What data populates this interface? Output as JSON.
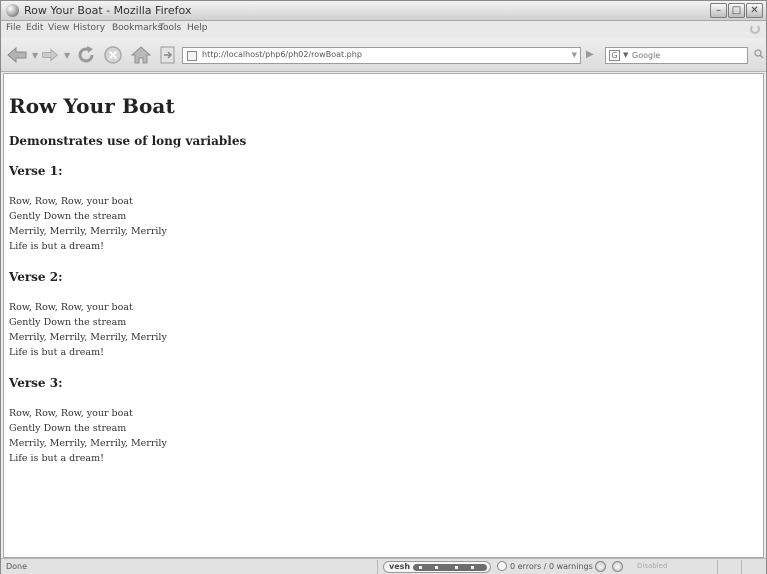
{
  "window": {
    "title": "Row Your Boat - Mozilla Firefox",
    "controls": [
      "minimize",
      "maximize",
      "close"
    ]
  },
  "menubar": {
    "items": [
      "File",
      "Edit",
      "View",
      "History",
      "Bookmarks",
      "Tools",
      "Help"
    ]
  },
  "navbar": {
    "url": "http://localhost/php6/ph02/rowBoat.php",
    "search_placeholder": "Google",
    "search_engine_letter": "G"
  },
  "page": {
    "heading": "Row Your Boat",
    "subheading": "Demonstrates use of long variables",
    "verses": [
      {
        "title": "Verse 1:",
        "lines": [
          "Row, Row, Row, your boat",
          "Gently Down the stream",
          "Merrily, Merrily, Merrily, Merrily",
          "Life is but a dream!"
        ]
      },
      {
        "title": "Verse 2:",
        "lines": [
          "Row, Row, Row, your boat",
          "Gently Down the stream",
          "Merrily, Merrily, Merrily, Merrily",
          "Life is but a dream!"
        ]
      },
      {
        "title": "Verse 3:",
        "lines": [
          "Row, Row, Row, your boat",
          "Gently Down the stream",
          "Merrily, Merrily, Merrily, Merrily",
          "Life is but a dream!"
        ]
      }
    ]
  },
  "statusbar": {
    "status": "Done",
    "vesh_label": "vesh",
    "errors": "0 errors / 0 warnings",
    "disabled": "Disabled"
  }
}
